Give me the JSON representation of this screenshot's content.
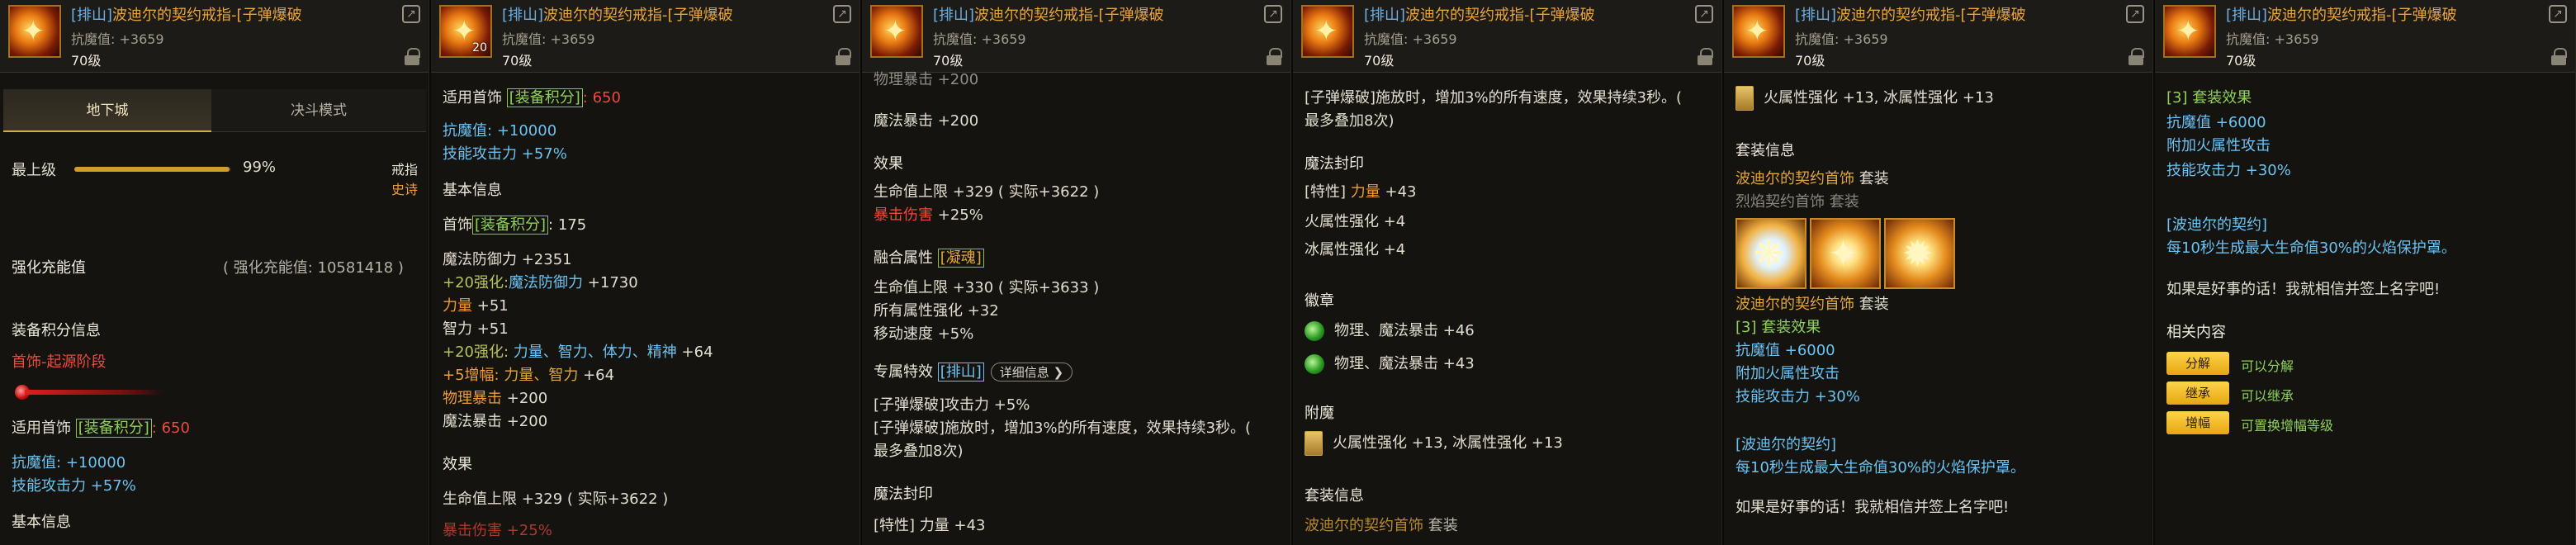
{
  "item": {
    "tag": "[排山]",
    "name": "波迪尔的契约戒指-[子弹爆破",
    "attr": "抗魔值: +3659",
    "level": "70级",
    "icon_lvl": "20",
    "share_icon": "share-icon",
    "lock_icon": "lock-icon"
  },
  "panel1": {
    "tabs": [
      "地下城",
      "决斗模式"
    ],
    "upgrade_label": "最上级",
    "upgrade_pct": "99%",
    "upgrade_fraction": 0.99,
    "type": "戒指",
    "rarity": "史诗",
    "reinforce_label": "强化充能值",
    "reinforce_value": "( 强化充能值: 10581418 )",
    "score_title": "装备积分信息",
    "score_stage": "首饰-起源阶段",
    "applies": "适用首饰",
    "score_box": "[装备积分]",
    "score_val": ": 650",
    "antimagic": "抗魔值:",
    "antimagic_val": "+10000",
    "skill_atk": "技能攻击力",
    "skill_atk_val": "+57%",
    "basic_title": "基本信息"
  },
  "panel2": {
    "applies": "适用首饰",
    "score_box": "[装备积分]",
    "score_val": ": 650",
    "antimagic": "抗魔值:",
    "antimagic_val": "+10000",
    "skill_atk": "技能攻击力",
    "skill_atk_val": "+57%",
    "basic_title": "基本信息",
    "acc": "首饰",
    "acc_box": "[装备积分]",
    "acc_val": ": 175",
    "mdef": "魔法防御力 +2351",
    "mdef_plus": "+20强化:",
    "mdef_plus_lbl": "魔法防御力",
    "mdef_plus_val": "+1730",
    "str": "力量",
    "str_val": "+51",
    "int": "智力 +51",
    "stat_plus": "+20强化:",
    "stat_list": "力量、智力、体力、精神",
    "stat_plus_val": "+64",
    "amp_plus": "+5增幅:",
    "amp_list": "力量、智力",
    "amp_val": "+64",
    "pcrit": "物理暴击",
    "pcrit_val": "+200",
    "mcrit": "魔法暴击 +200",
    "effect_title": "效果",
    "hp": "生命值上限 +329 ( 实际+3622 )",
    "critdmg": "暴击伤害 +25%"
  },
  "panel3": {
    "pcrit_top": "物理暴击 +200",
    "mcrit": "魔法暴击 +200",
    "effect_title": "效果",
    "hp": "生命值上限 +329 ( 实际+3622 )",
    "critdmg": "暴击伤害",
    "critdmg_val": "+25%",
    "fusion_title": "融合属性",
    "fusion_tag": "[凝魂]",
    "fusion_hp": "生命值上限 +330 ( 实际+3633 )",
    "fusion_elem": "所有属性强化 +32",
    "fusion_speed": "移动速度 +5%",
    "special_title": "专属特效",
    "special_tag": "[排山]",
    "detail_btn": "详细信息",
    "special_1": "[子弹爆破]攻击力 +5%",
    "special_2": "[子弹爆破]施放时，增加3%的所有速度，效果持续3秒。(",
    "special_3": "最多叠加8次)",
    "seal_title": "魔法封印",
    "seal_trait": "[特性] 力量 +43"
  },
  "panel4": {
    "special_2": "[子弹爆破]施放时，增加3%的所有速度，效果持续3秒。(",
    "special_3": "最多叠加8次)",
    "seal_title": "魔法封印",
    "seal_trait": "[特性]",
    "seal_trait_lbl": "力量",
    "seal_trait_val": "+43",
    "seal_fire": "火属性强化 +4",
    "seal_ice": "冰属性强化 +4",
    "emblem_title": "徽章",
    "emblem_1": "物理、魔法暴击",
    "emblem_1_val": "+46",
    "emblem_2": "物理、魔法暴击",
    "emblem_2_val": "+43",
    "enchant_title": "附魔",
    "enchant": "火属性强化 +13, 冰属性强化 +13",
    "set_title": "套装信息",
    "set_name": "波迪尔的契约首饰",
    "set_tag": "套装"
  },
  "panel5": {
    "enchant": "火属性强化 +13, 冰属性强化 +13",
    "set_title": "套装信息",
    "set_name": "波迪尔的契约首饰",
    "set_tag": "套装",
    "set_sub": "烈焰契约首饰",
    "set_sub_tag": "套装",
    "set_name2": "波迪尔的契约首饰",
    "set_tag2": "套装",
    "set_effect": "[3] 套装效果",
    "se_anti": "抗魔值",
    "se_anti_val": "+6000",
    "se_fire": "附加火属性攻击",
    "se_skill": "技能攻击力",
    "se_skill_val": "+30%",
    "contract": "[波迪尔的契约]",
    "contract_desc": "每10秒生成最大生命值30%的火焰保护罩。",
    "flavor": "如果是好事的话！我就相信并签上名字吧!"
  },
  "panel6": {
    "set_effect": "[3] 套装效果",
    "se_anti": "抗魔值",
    "se_anti_val": "+6000",
    "se_fire": "附加火属性攻击",
    "se_skill": "技能攻击力",
    "se_skill_val": "+30%",
    "contract": "[波迪尔的契约]",
    "contract_desc": "每10秒生成最大生命值30%的火焰保护罩。",
    "flavor": "如果是好事的话！我就相信并签上名字吧!",
    "related_title": "相关内容",
    "ops": [
      {
        "label": "分解",
        "desc": "可以分解"
      },
      {
        "label": "继承",
        "desc": "可以继承"
      },
      {
        "label": "增幅",
        "desc": "可置换增幅等级"
      }
    ]
  },
  "colors": {
    "gold": "#e0a63a",
    "blue": "#6cc2f0",
    "green": "#8fd15c",
    "red": "#ee4a3a",
    "button": "#f2bf2a"
  }
}
